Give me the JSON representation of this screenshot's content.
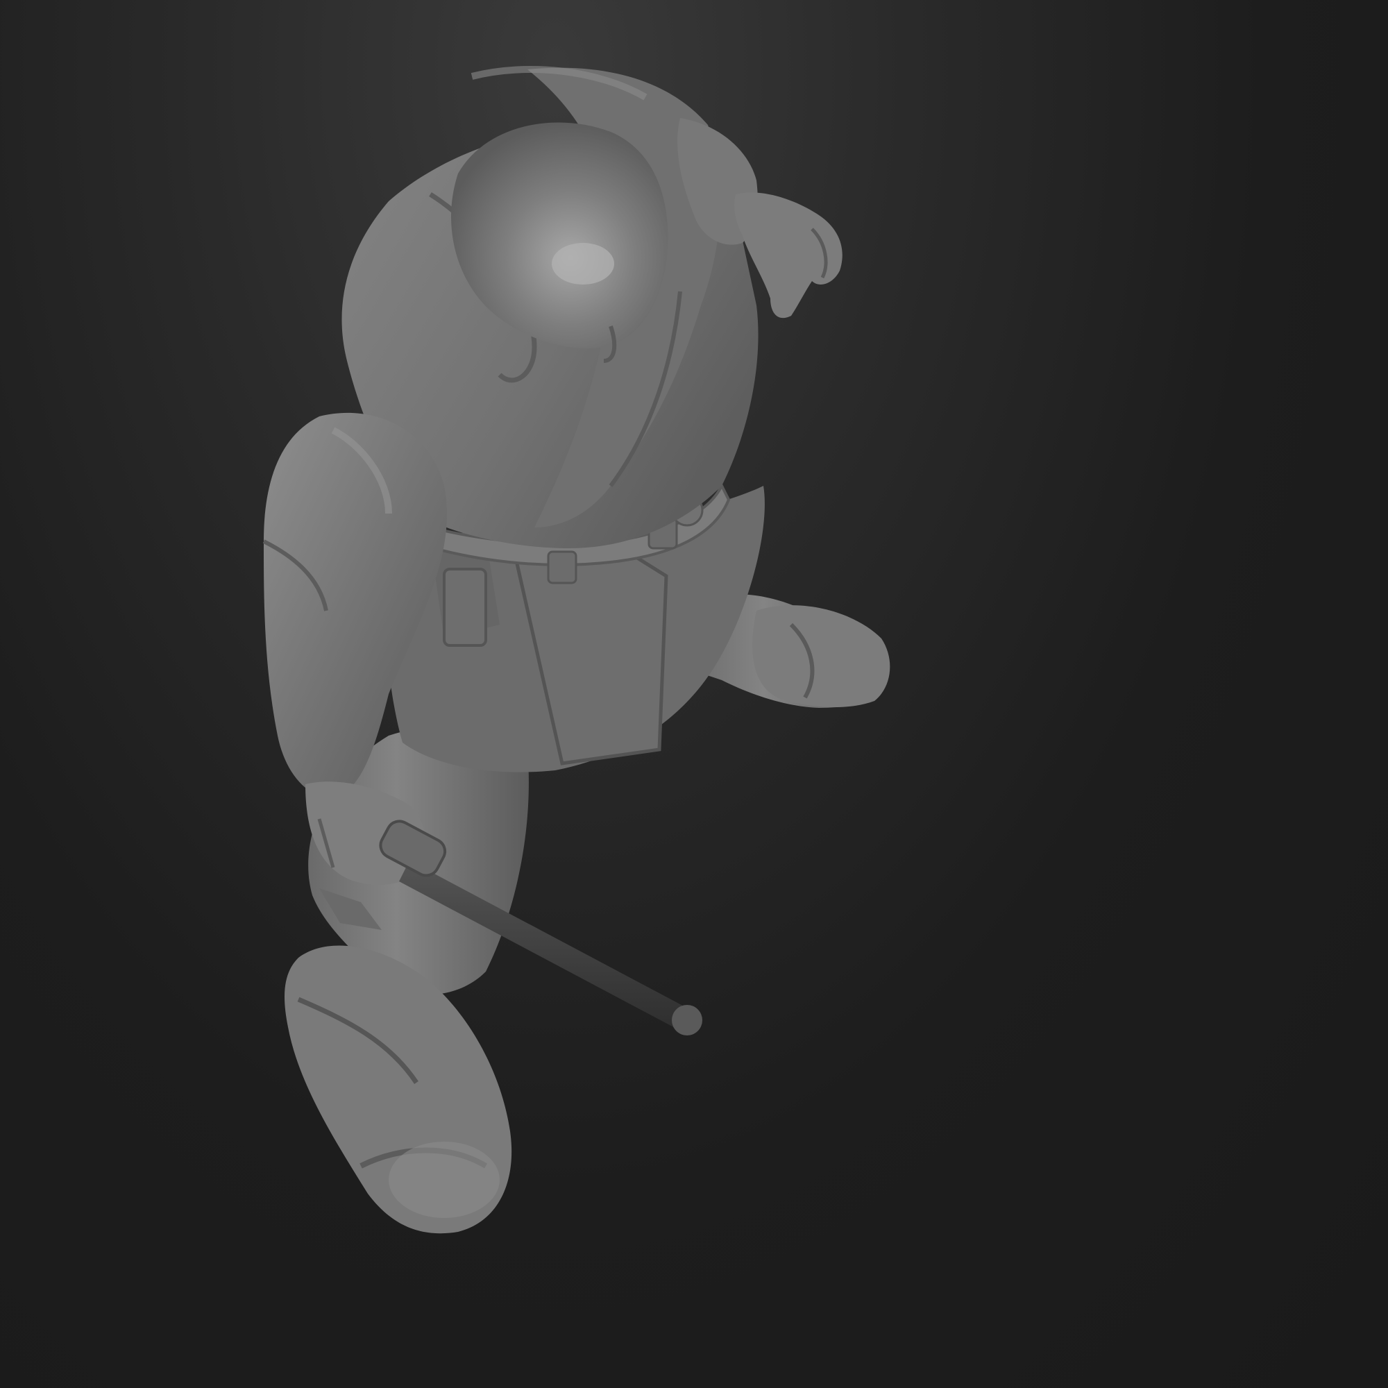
{
  "scene": {
    "background_color": "#1b1b1b",
    "model_color": "#7a7a7a",
    "model_highlight_color": "#a4a4a4",
    "model_shadow_color": "#4e4e4e",
    "staff_color": "#3c3c3c"
  }
}
